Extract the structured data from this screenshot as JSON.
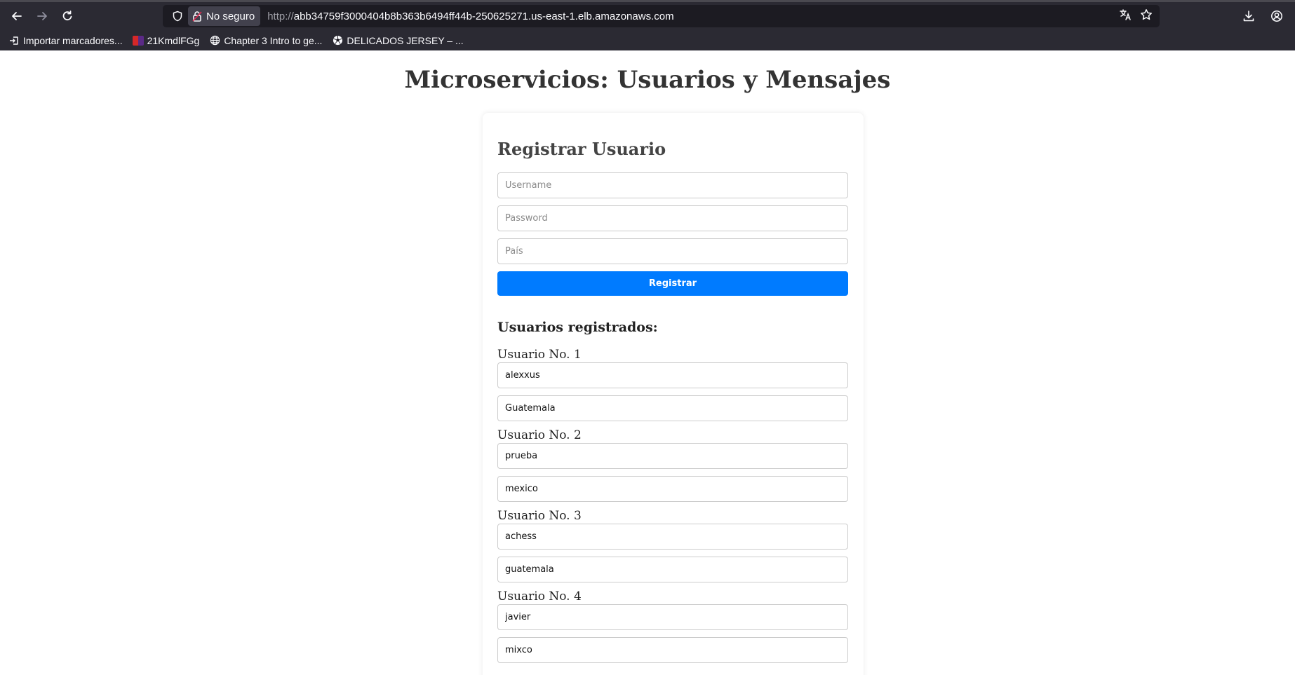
{
  "browser": {
    "security_label": "No seguro",
    "url_scheme": "http://",
    "url_host": "abb34759f3000404b8b363b6494ff44b-250625271.us-east-1.elb.amazonaws.com",
    "icons": [
      "back-icon",
      "forward-icon",
      "reload-icon",
      "shield-icon",
      "insecure-lock-icon",
      "translate-icon",
      "bookmark-star-icon",
      "download-icon",
      "account-icon"
    ],
    "bookmarks": [
      {
        "label": "Importar marcadores...",
        "icon": "import-icon"
      },
      {
        "label": "21KmdlFGg",
        "icon": "flag-favicon"
      },
      {
        "label": "Chapter 3 Intro to ge...",
        "icon": "globe-icon"
      },
      {
        "label": "DELICADOS JERSEY – ...",
        "icon": "soccer-ball-icon"
      }
    ]
  },
  "page": {
    "title": "Microservicios: Usuarios y Mensajes",
    "register": {
      "heading": "Registrar Usuario",
      "username_placeholder": "Username",
      "password_placeholder": "Password",
      "country_placeholder": "País",
      "submit_label": "Registrar"
    },
    "users_heading": "Usuarios registrados:",
    "users": [
      {
        "label": "Usuario No. 1",
        "username": "alexxus",
        "country": "Guatemala"
      },
      {
        "label": "Usuario No. 2",
        "username": "prueba",
        "country": "mexico"
      },
      {
        "label": "Usuario No. 3",
        "username": "achess",
        "country": "guatemala"
      },
      {
        "label": "Usuario No. 4",
        "username": "javier",
        "country": "mixco"
      }
    ]
  },
  "colors": {
    "chrome_bg": "#2b2a33",
    "urlbar_bg": "#1c1b22",
    "primary_button": "#007bff"
  }
}
